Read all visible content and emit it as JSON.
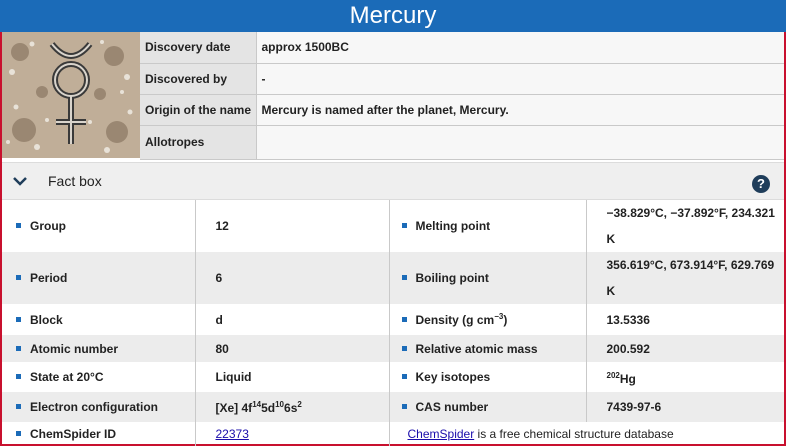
{
  "title": "Mercury",
  "discovery": [
    {
      "key": "Discovery date",
      "value": "approx 1500BC"
    },
    {
      "key": "Discovered by",
      "value": "-"
    },
    {
      "key": "Origin of the name",
      "value": "Mercury is named after the planet, Mercury."
    },
    {
      "key": "Allotropes",
      "value": ""
    }
  ],
  "factbox": {
    "label": "Fact box",
    "help": "?"
  },
  "facts": {
    "group": {
      "label": "Group",
      "value": "12"
    },
    "melting": {
      "label": "Melting point",
      "value": "−38.829°C, −37.892°F, 234.321 K"
    },
    "period": {
      "label": "Period",
      "value": "6"
    },
    "boiling": {
      "label": "Boiling point",
      "value": "356.619°C, 673.914°F, 629.769 K"
    },
    "block": {
      "label": "Block",
      "value": "d"
    },
    "density": {
      "label_pre": "Density (g cm",
      "label_sup": "−3",
      "label_post": ")",
      "value": "13.5336"
    },
    "atomic_number": {
      "label": "Atomic number",
      "value": "80"
    },
    "mass": {
      "label": "Relative atomic mass",
      "value": "200.592"
    },
    "state": {
      "label": "State at 20°C",
      "value": "Liquid"
    },
    "isotopes": {
      "label": "Key isotopes",
      "sup": "202",
      "value": "Hg"
    },
    "electron": {
      "label": "Electron configuration",
      "pre": "[Xe] 4f",
      "s1": "14",
      "m1": "5d",
      "s2": "10",
      "m2": "6s",
      "s3": "2"
    },
    "cas": {
      "label": "CAS number",
      "value": "7439-97-6"
    },
    "chemspider": {
      "label": "ChemSpider ID",
      "value": "22373",
      "link": "ChemSpider",
      "rest": " is a free chemical structure database"
    }
  }
}
